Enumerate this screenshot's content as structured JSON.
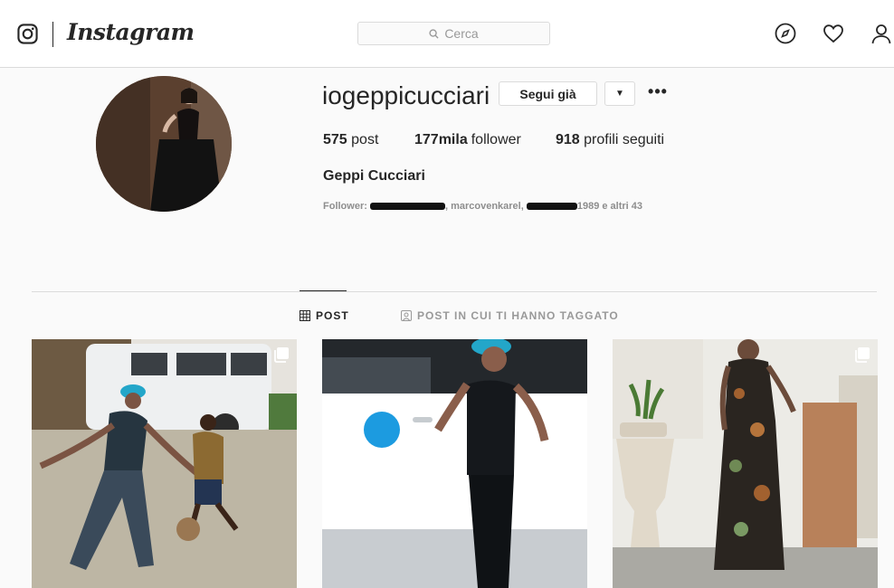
{
  "nav": {
    "brand": "Instagram",
    "search_placeholder": "Cerca"
  },
  "profile": {
    "username": "iogeppicucciari",
    "follow_button": "Segui già",
    "dropdown_arrow": "▼",
    "more_dots": "•••",
    "stats": {
      "posts_count": "575",
      "posts_label": "post",
      "followers_count": "177mila",
      "followers_label": "follower",
      "following_count": "918",
      "following_label": "profili seguiti"
    },
    "full_name": "Geppi Cucciari",
    "followed_by_prefix": "Follower:",
    "followed_by_visible": ", marcovenkarel, ",
    "followed_by_suffix": "1989 e altri 43"
  },
  "tabs": [
    {
      "label": "POST",
      "active": true
    },
    {
      "label": "POST IN CUI TI HANNO TAGGATO",
      "active": false
    }
  ],
  "colors": {
    "text": "#262626",
    "muted": "#8e8e8e",
    "border": "#dbdbdb",
    "background": "#fafafa"
  }
}
